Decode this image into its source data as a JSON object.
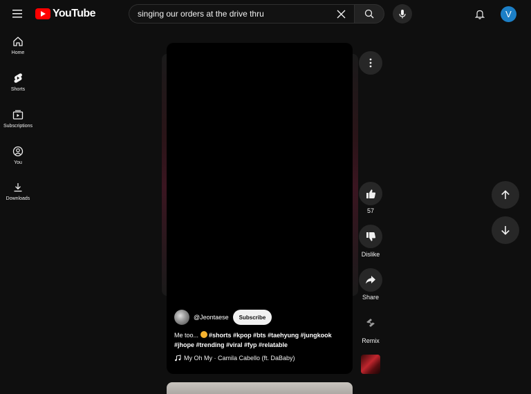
{
  "header": {
    "logo_text": "YouTube",
    "search": {
      "value": "singing our orders at the drive thru"
    },
    "avatar_letter": "V"
  },
  "sidebar": {
    "items": [
      {
        "label": "Home",
        "icon": "home-icon"
      },
      {
        "label": "Shorts",
        "icon": "shorts-icon"
      },
      {
        "label": "Subscriptions",
        "icon": "subscriptions-icon"
      },
      {
        "label": "You",
        "icon": "you-icon"
      },
      {
        "label": "Downloads",
        "icon": "download-icon"
      }
    ]
  },
  "short": {
    "channel": "@Jeontaese",
    "subscribe_label": "Subscribe",
    "caption_text": "Me too...",
    "caption_tags_line1": "#shorts #kpop #bts #taehyung #jungkook",
    "caption_tags_line2": "#jhope #trending #viral #fyp #relatable",
    "music": "My Oh My · Camila Cabello (ft. DaBaby)"
  },
  "actions": {
    "like_count": "57",
    "dislike_label": "Dislike",
    "share_label": "Share",
    "remix_label": "Remix"
  },
  "colors": {
    "background": "#0f0f0f",
    "brand_red": "#ff0000",
    "avatar_blue": "#1c7fc6",
    "button_gray": "#272727"
  }
}
